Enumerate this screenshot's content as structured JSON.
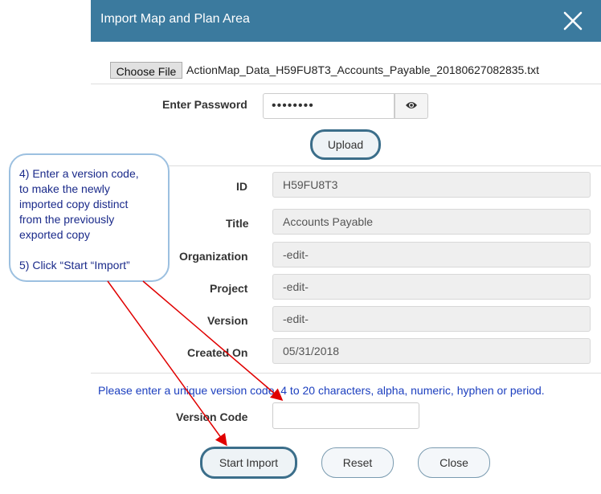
{
  "dialog": {
    "title": "Import Map and Plan Area"
  },
  "file": {
    "choose_label": "Choose File",
    "file_name": "ActionMap_Data_H59FU8T3_Accounts_Payable_20180627082835.txt"
  },
  "password": {
    "label": "Enter Password",
    "value": "••••••••"
  },
  "upload_label": "Upload",
  "fields": {
    "id": {
      "label": "ID",
      "value": "H59FU8T3"
    },
    "title": {
      "label": "Title",
      "value": "Accounts Payable"
    },
    "organization": {
      "label": "Organization",
      "value": "-edit-"
    },
    "project": {
      "label": "Project",
      "value": "-edit-"
    },
    "version": {
      "label": "Version",
      "value": "-edit-"
    },
    "created_on": {
      "label": "Created On",
      "value": "05/31/2018"
    }
  },
  "version_note": "Please enter a unique version code, 4 to 20 characters, alpha, numeric, hyphen or period.",
  "version_code": {
    "label": "Version Code",
    "value": ""
  },
  "buttons": {
    "start_import": "Start Import",
    "reset": "Reset",
    "close": "Close"
  },
  "callout": {
    "line1": "4) Enter a version code,",
    "line2": "to make the newly",
    "line3": "imported copy distinct",
    "line4": "from the previously",
    "line5": "exported copy",
    "line6": "5) Click “Start “Import”"
  },
  "colors": {
    "titlebar": "#3b7a9e",
    "note_text": "#1c3fbf",
    "callout_text": "#1a2a8a",
    "arrow": "#e00000"
  }
}
